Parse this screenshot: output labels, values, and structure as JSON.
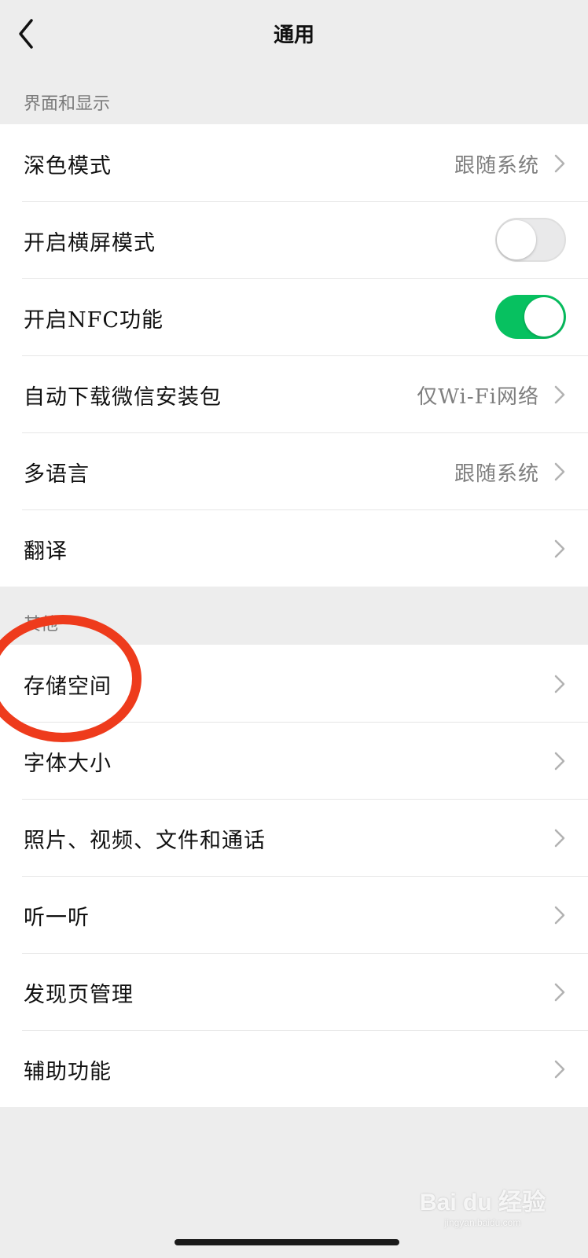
{
  "header": {
    "title": "通用",
    "back_icon": "chevron-left-icon"
  },
  "sections": {
    "display": {
      "header": "界面和显示"
    },
    "other": {
      "header": "其他"
    }
  },
  "display_rows": [
    {
      "label": "深色模式",
      "value": "跟随系统",
      "control": "chevron"
    },
    {
      "label": "开启横屏模式",
      "control": "toggle",
      "on": false
    },
    {
      "label": "开启NFC功能",
      "control": "toggle",
      "on": true
    },
    {
      "label": "自动下载微信安装包",
      "value": "仅Wi-Fi网络",
      "control": "chevron"
    },
    {
      "label": "多语言",
      "value": "跟随系统",
      "control": "chevron"
    },
    {
      "label": "翻译",
      "control": "chevron"
    }
  ],
  "other_rows": [
    {
      "label": "存储空间"
    },
    {
      "label": "字体大小"
    },
    {
      "label": "照片、视频、文件和通话"
    },
    {
      "label": "听一听"
    },
    {
      "label": "发现页管理"
    },
    {
      "label": "辅助功能"
    }
  ],
  "colors": {
    "toggle_on": "#07c160",
    "annotation_circle": "#ee3b1c",
    "background": "#ededed"
  },
  "watermark": {
    "text": "Bai du 经验",
    "sub": "jingyan.baidu.com"
  }
}
